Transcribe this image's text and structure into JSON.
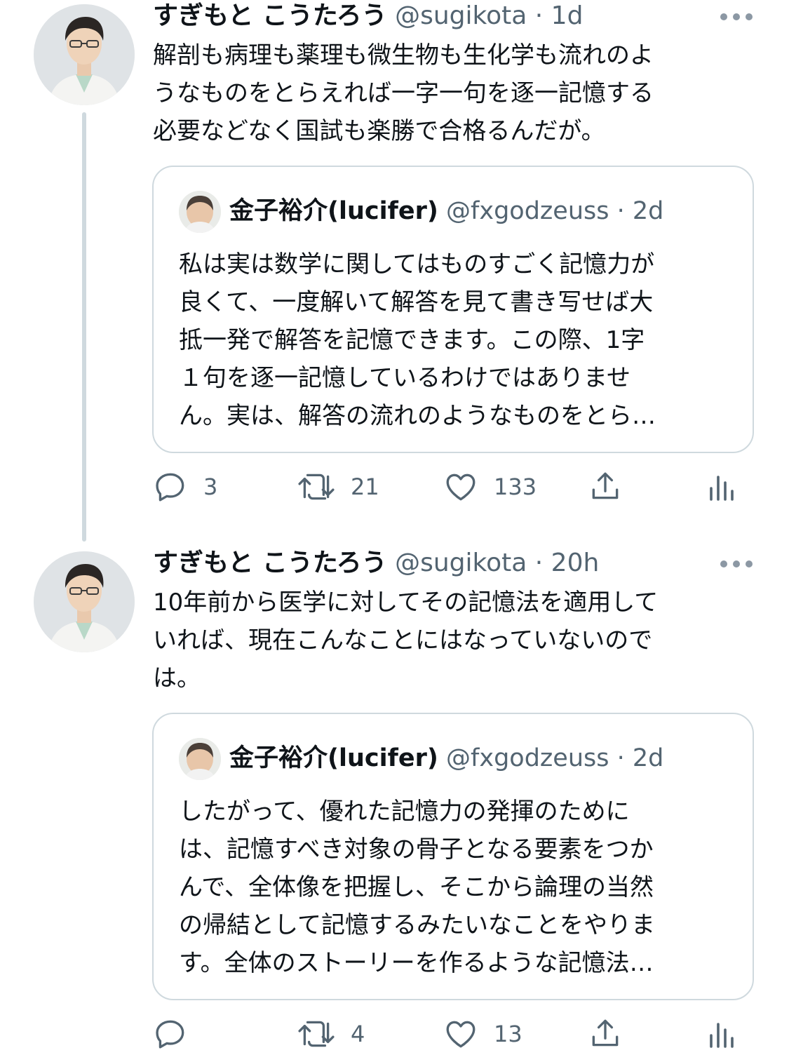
{
  "tweets": [
    {
      "author": {
        "name": "すぎもと こうたろう",
        "handle": "@sugikota",
        "time": "1d"
      },
      "text": "解剖も病理も薬理も微生物も生化学も流れのよ\nうなものをとらえれば一字一句を逐一記憶する\n必要などなく国試も楽勝で合格るんだが。",
      "quote": {
        "name": "金子裕介(lucifer)",
        "handle": "@fxgodzeuss",
        "time": "2d",
        "text": "私は実は数学に関してはものすごく記憶力が\n良くて、一度解いて解答を見て書き写せば大\n抵一発で解答を記憶できます。この際、1字\n１句を逐一記憶しているわけではありませ\nん。実は、解答の流れのようなものをとら…"
      },
      "counts": {
        "replies": "3",
        "retweets": "21",
        "likes": "133"
      }
    },
    {
      "author": {
        "name": "すぎもと こうたろう",
        "handle": "@sugikota",
        "time": "20h"
      },
      "text": "10年前から医学に対してその記憶法を適用して\nいれば、現在こんなことにはなっていないので\nは。",
      "quote": {
        "name": "金子裕介(lucifer)",
        "handle": "@fxgodzeuss",
        "time": "2d",
        "text": "したがって、優れた記憶力の発揮のために\nは、記憶すべき対象の骨子となる要素をつか\nんで、全体像を把握し、そこから論理の当然\nの帰結として記憶するみたいなことをやりま\nす。全体のストーリーを作るような記憶法…"
      },
      "counts": {
        "replies": "",
        "retweets": "4",
        "likes": "13"
      }
    }
  ],
  "separator": "·",
  "icons": [
    "reply-icon",
    "retweet-icon",
    "like-icon",
    "share-icon",
    "analytics-icon",
    "more-icon"
  ],
  "colors": {
    "text": "#0f1419",
    "secondary": "#536471",
    "border": "#cfd9de",
    "thread_line": "#cfd9de"
  }
}
